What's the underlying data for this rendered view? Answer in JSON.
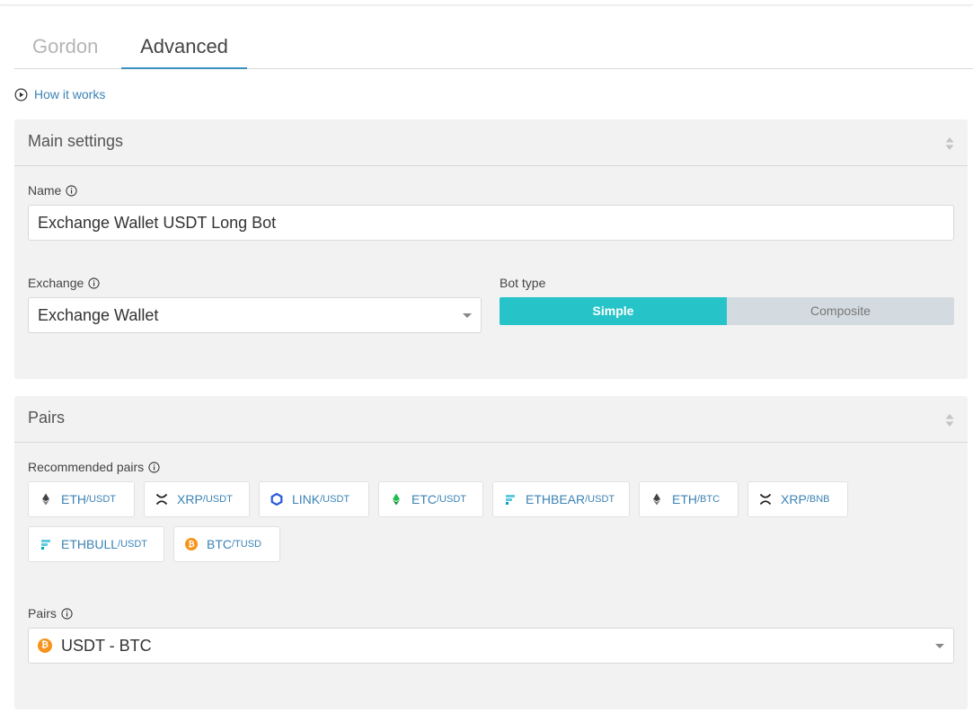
{
  "tabs": [
    {
      "label": "Gordon",
      "active": false
    },
    {
      "label": "Advanced",
      "active": true
    }
  ],
  "how_it_works": "How it works",
  "main_settings": {
    "title": "Main settings",
    "name_label": "Name",
    "name_value": "Exchange Wallet USDT Long Bot",
    "exchange_label": "Exchange",
    "exchange_value": "Exchange Wallet",
    "bot_type_label": "Bot type",
    "bot_type_options": [
      "Simple",
      "Composite"
    ],
    "bot_type_selected": "Simple"
  },
  "pairs_section": {
    "title": "Pairs",
    "recommended_label": "Recommended pairs",
    "recommended": [
      {
        "base": "ETH",
        "quote": "/USDT",
        "icon": "eth-icon"
      },
      {
        "base": "XRP",
        "quote": "/USDT",
        "icon": "xrp-icon"
      },
      {
        "base": "LINK",
        "quote": "/USDT",
        "icon": "link-icon"
      },
      {
        "base": "ETC",
        "quote": "/USDT",
        "icon": "etc-icon"
      },
      {
        "base": "ETHBEAR",
        "quote": "/USDT",
        "icon": "ftx-icon"
      },
      {
        "base": "ETH",
        "quote": "/BTC",
        "icon": "eth-icon"
      },
      {
        "base": "XRP",
        "quote": "/BNB",
        "icon": "xrp-icon"
      },
      {
        "base": "ETHBULL",
        "quote": "/USDT",
        "icon": "ftx-icon"
      },
      {
        "base": "BTC",
        "quote": "/TUSD",
        "icon": "btc-icon"
      }
    ],
    "pairs_label": "Pairs",
    "pairs_value": "USDT - BTC",
    "btc_symbol": "₿"
  },
  "colors": {
    "accent_teal": "#26c4c8",
    "link_blue": "#3b83b5",
    "tab_underline": "#3b8fbe",
    "btc_orange": "#f7931a"
  }
}
